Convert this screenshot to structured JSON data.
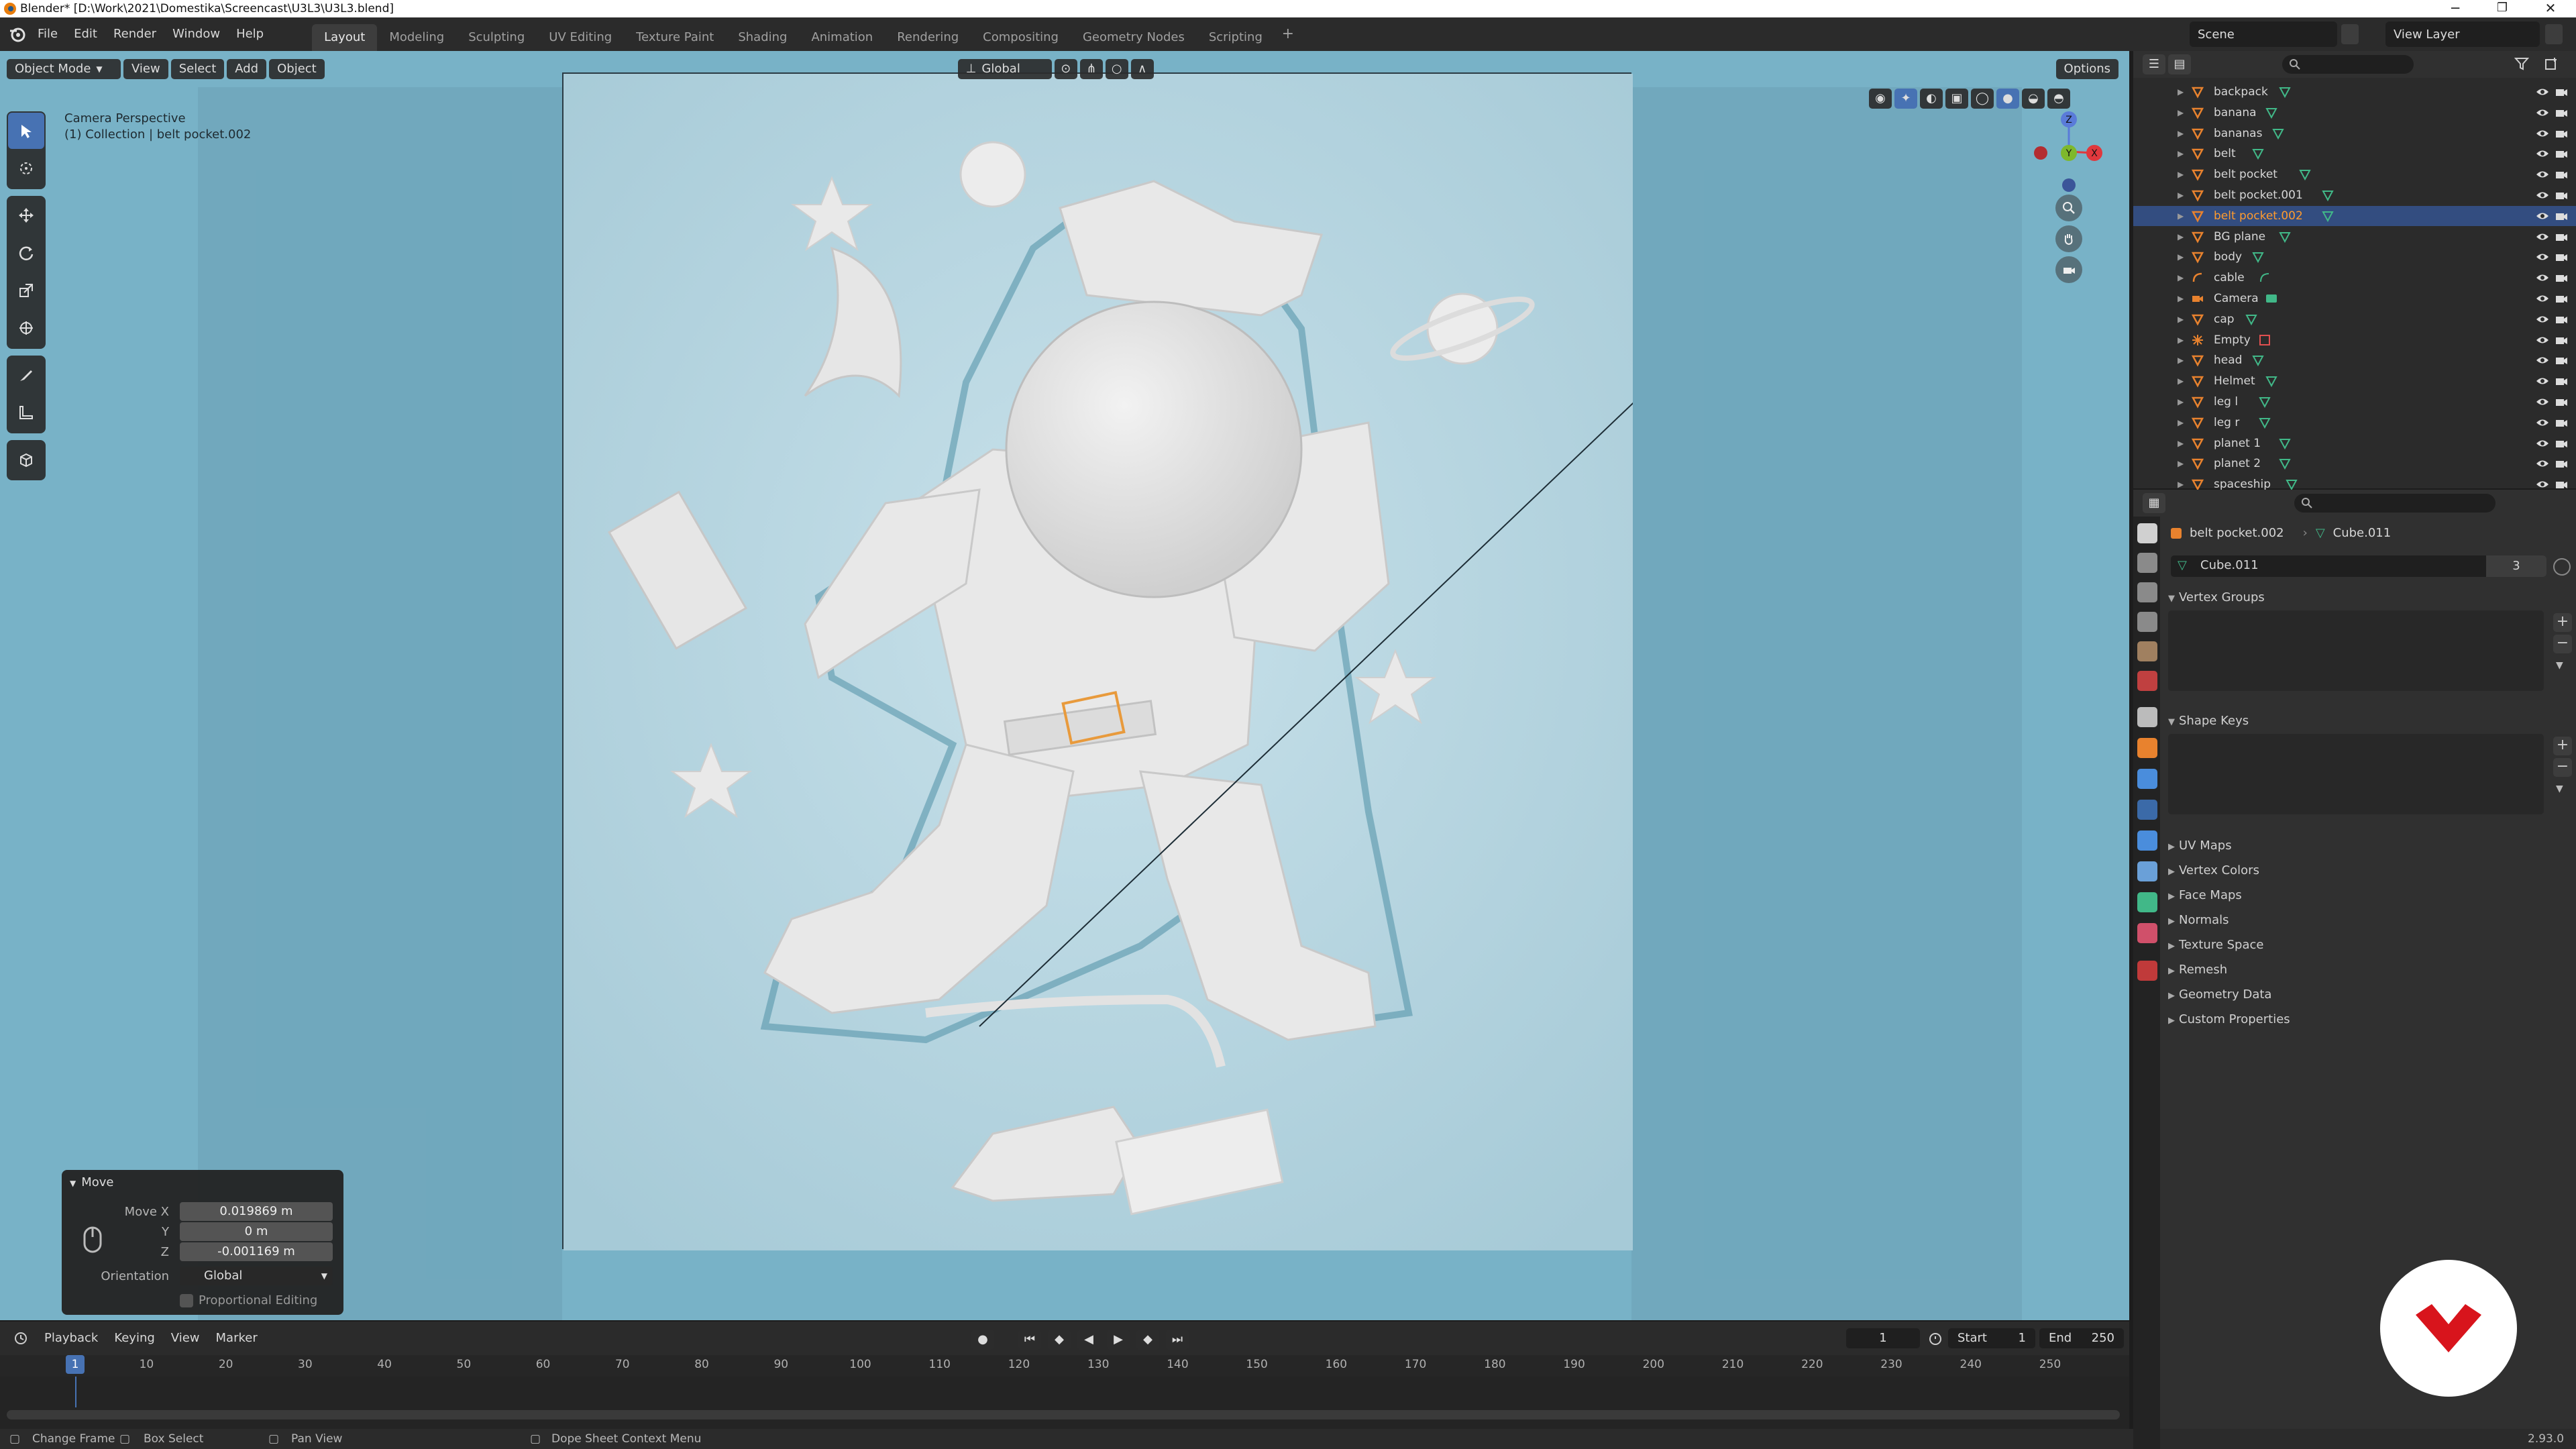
{
  "window": {
    "title": "Blender* [D:\\Work\\2021\\Domestika\\Screencast\\U3L3\\U3L3.blend]",
    "minimize": "─",
    "maximize": "❐",
    "close": "✕"
  },
  "menu": {
    "file": "File",
    "edit": "Edit",
    "render": "Render",
    "window": "Window",
    "help": "Help"
  },
  "workspaces": [
    "Layout",
    "Modeling",
    "Sculpting",
    "UV Editing",
    "Texture Paint",
    "Shading",
    "Animation",
    "Rendering",
    "Compositing",
    "Geometry Nodes",
    "Scripting"
  ],
  "workspace_add": "+",
  "scene": {
    "scene_name": "Scene",
    "view_layer": "View Layer"
  },
  "viewport": {
    "mode": "Object Mode",
    "menus": {
      "view": "View",
      "select": "Select",
      "add": "Add",
      "object": "Object"
    },
    "transform_orientation": "Global",
    "options": "Options",
    "overlay_line1": "Camera Perspective",
    "overlay_line2": "(1) Collection | belt pocket.002",
    "gizmo": {
      "z": "Z",
      "y": "Y",
      "x": "X"
    }
  },
  "move_panel": {
    "title": "Move",
    "move_x_label": "Move X",
    "move_x": "0.019869 m",
    "y_label": "Y",
    "y": "0 m",
    "z_label": "Z",
    "z": "-0.001169 m",
    "orientation_label": "Orientation",
    "orientation": "Global",
    "proportional": "Proportional Editing"
  },
  "timeline": {
    "menus": {
      "playback": "Playback",
      "keying": "Keying",
      "view": "View",
      "marker": "Marker"
    },
    "current_frame": "1",
    "start_label": "Start",
    "start": "1",
    "end_label": "End",
    "end": "250",
    "ticks": [
      "10",
      "20",
      "30",
      "40",
      "50",
      "60",
      "70",
      "80",
      "90",
      "100",
      "110",
      "120",
      "130",
      "140",
      "150",
      "160",
      "170",
      "180",
      "190",
      "200",
      "210",
      "220",
      "230",
      "240",
      "250"
    ],
    "playhead": "1"
  },
  "statusbar": {
    "change_frame": "Change Frame",
    "box_select": "Box Select",
    "pan_view": "Pan View",
    "context_menu": "Dope Sheet Context Menu",
    "version": "2.93.0"
  },
  "outliner": {
    "items": [
      {
        "name": "backpack",
        "type": "mesh",
        "selected": false
      },
      {
        "name": "banana",
        "type": "mesh",
        "selected": false
      },
      {
        "name": "bananas",
        "type": "mesh",
        "selected": false
      },
      {
        "name": "belt",
        "type": "mesh",
        "selected": false
      },
      {
        "name": "belt pocket",
        "type": "mesh",
        "selected": false
      },
      {
        "name": "belt pocket.001",
        "type": "mesh",
        "selected": false
      },
      {
        "name": "belt pocket.002",
        "type": "mesh",
        "selected": true
      },
      {
        "name": "BG plane",
        "type": "mesh",
        "selected": false
      },
      {
        "name": "body",
        "type": "mesh",
        "selected": false
      },
      {
        "name": "cable",
        "type": "curve",
        "selected": false
      },
      {
        "name": "Camera",
        "type": "camera",
        "selected": false
      },
      {
        "name": "cap",
        "type": "mesh",
        "selected": false
      },
      {
        "name": "Empty",
        "type": "empty",
        "selected": false
      },
      {
        "name": "head",
        "type": "mesh",
        "selected": false
      },
      {
        "name": "Helmet",
        "type": "mesh",
        "selected": false
      },
      {
        "name": "leg l",
        "type": "mesh",
        "selected": false
      },
      {
        "name": "leg r",
        "type": "mesh",
        "selected": false
      },
      {
        "name": "planet 1",
        "type": "mesh",
        "selected": false
      },
      {
        "name": "planet 2",
        "type": "mesh",
        "selected": false
      },
      {
        "name": "spaceship",
        "type": "mesh",
        "selected": false
      }
    ]
  },
  "properties": {
    "object_name": "belt pocket.002",
    "mesh_name": "Cube.011",
    "datablock": "Cube.011",
    "users": "3",
    "panels": {
      "vertex_groups": "Vertex Groups",
      "shape_keys": "Shape Keys",
      "uv_maps": "UV Maps",
      "vertex_colors": "Vertex Colors",
      "face_maps": "Face Maps",
      "normals": "Normals",
      "texture_space": "Texture Space",
      "remesh": "Remesh",
      "geometry_data": "Geometry Data",
      "custom_properties": "Custom Properties"
    },
    "add": "+",
    "remove": "−"
  },
  "colors": {
    "accent": "#4772b3",
    "selected_text": "#ff9b2e",
    "viewport_bg": "#78b2c7",
    "badge_red": "#d8141c"
  }
}
